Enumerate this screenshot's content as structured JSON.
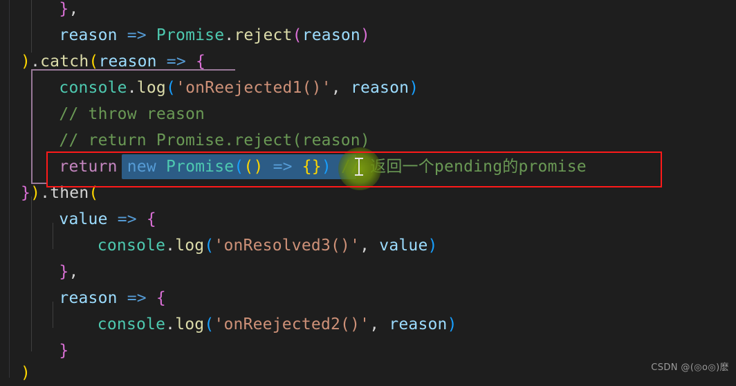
{
  "editor": {
    "app": "code-editor",
    "theme": "dark-plus",
    "background": "#1e1e1e",
    "font_size_px": 23,
    "line_height_px": 38
  },
  "colors": {
    "keyword_magenta": "#c586c0",
    "keyword_blue": "#569cd6",
    "class_teal": "#4ec9b0",
    "function_yellow": "#dcdcaa",
    "variable_blue": "#9cdcfe",
    "string_salmon": "#ce9178",
    "comment_green": "#6a9955",
    "bracket_yellow": "#ffd700",
    "bracket_pink": "#da70d6",
    "bracket_blue": "#179fff",
    "selection_blue": "#2c5c86",
    "annotation_red": "#ff1a1a",
    "scope_guide_purple": "#9a7a9a",
    "indent_guide_gray": "#404040",
    "click_glow_green": "#7ea010"
  },
  "code_lines": [
    {
      "id": "line-1",
      "indent": "    ",
      "tokens": [
        {
          "text": "}",
          "color": "bracket_pink"
        },
        {
          "text": ",",
          "color": "punct"
        }
      ],
      "plain": "    },"
    },
    {
      "id": "line-2",
      "indent": "    ",
      "tokens": [
        {
          "text": "reason",
          "color": "variable_blue"
        },
        {
          "text": " ",
          "color": "punct"
        },
        {
          "text": "=>",
          "color": "keyword_blue"
        },
        {
          "text": " ",
          "color": "punct"
        },
        {
          "text": "Promise",
          "color": "class_teal"
        },
        {
          "text": ".",
          "color": "punct"
        },
        {
          "text": "reject",
          "color": "function_yellow"
        },
        {
          "text": "(",
          "color": "bracket_pink"
        },
        {
          "text": "reason",
          "color": "variable_blue"
        },
        {
          "text": ")",
          "color": "bracket_pink"
        }
      ],
      "plain": "    reason => Promise.reject(reason)"
    },
    {
      "id": "line-3",
      "indent": "",
      "tokens": [
        {
          "text": ")",
          "color": "bracket_yellow"
        },
        {
          "text": ".",
          "color": "punct"
        },
        {
          "text": "catch",
          "color": "function_yellow"
        },
        {
          "text": "(",
          "color": "bracket_yellow"
        },
        {
          "text": "reason",
          "color": "variable_blue"
        },
        {
          "text": " ",
          "color": "punct"
        },
        {
          "text": "=>",
          "color": "keyword_blue"
        },
        {
          "text": " ",
          "color": "punct"
        },
        {
          "text": "{",
          "color": "bracket_pink"
        }
      ],
      "plain": ").catch(reason => {"
    },
    {
      "id": "line-4",
      "indent": "    ",
      "tokens": [
        {
          "text": "console",
          "color": "class_teal"
        },
        {
          "text": ".",
          "color": "punct"
        },
        {
          "text": "log",
          "color": "function_yellow"
        },
        {
          "text": "(",
          "color": "bracket_blue"
        },
        {
          "text": "'onReejected1()'",
          "color": "string_salmon"
        },
        {
          "text": ",",
          "color": "punct"
        },
        {
          "text": " ",
          "color": "punct"
        },
        {
          "text": "reason",
          "color": "variable_blue"
        },
        {
          "text": ")",
          "color": "bracket_blue"
        }
      ],
      "plain": "    console.log('onReejected1()', reason)"
    },
    {
      "id": "line-5",
      "indent": "    ",
      "tokens": [
        {
          "text": "// throw reason",
          "color": "comment_green"
        }
      ],
      "plain": "    // throw reason"
    },
    {
      "id": "line-6",
      "indent": "    ",
      "tokens": [
        {
          "text": "// return Promise.reject(reason)",
          "color": "comment_green"
        }
      ],
      "plain": "    // return Promise.reject(reason)"
    },
    {
      "id": "line-7",
      "indent": "    ",
      "highlighted": true,
      "tokens": [
        {
          "text": "return",
          "color": "keyword_magenta"
        },
        {
          "text": " ",
          "color": "punct"
        },
        {
          "text": "new",
          "color": "keyword_blue",
          "selected": true
        },
        {
          "text": " ",
          "color": "punct",
          "selected": true
        },
        {
          "text": "Promise",
          "color": "class_teal",
          "selected": true
        },
        {
          "text": "(",
          "color": "bracket_blue",
          "selected": true
        },
        {
          "text": "(",
          "color": "bracket_yellow",
          "selected": true
        },
        {
          "text": ")",
          "color": "bracket_yellow",
          "selected": true
        },
        {
          "text": " ",
          "color": "punct",
          "selected": true
        },
        {
          "text": "=>",
          "color": "keyword_blue",
          "selected": true
        },
        {
          "text": " ",
          "color": "punct",
          "selected": true
        },
        {
          "text": "{",
          "color": "bracket_yellow",
          "selected": true
        },
        {
          "text": "}",
          "color": "bracket_yellow",
          "selected": true
        },
        {
          "text": ")",
          "color": "bracket_blue",
          "selected": true
        },
        {
          "text": " ",
          "color": "punct"
        },
        {
          "text": "// 返回一个pending的promise",
          "color": "comment_green"
        }
      ],
      "plain": "    return new Promise(() => {}) // 返回一个pending的promise"
    },
    {
      "id": "line-8",
      "indent": "",
      "tokens": [
        {
          "text": "}",
          "color": "bracket_pink"
        },
        {
          "text": ")",
          "color": "bracket_yellow"
        },
        {
          "text": ".",
          "color": "punct"
        },
        {
          "text": "then",
          "color": "plain"
        },
        {
          "text": "(",
          "color": "bracket_yellow"
        }
      ],
      "plain": "}).then("
    },
    {
      "id": "line-9",
      "indent": "    ",
      "tokens": [
        {
          "text": "value",
          "color": "variable_blue"
        },
        {
          "text": " ",
          "color": "punct"
        },
        {
          "text": "=>",
          "color": "keyword_blue"
        },
        {
          "text": " ",
          "color": "punct"
        },
        {
          "text": "{",
          "color": "bracket_pink"
        }
      ],
      "plain": "    value => {"
    },
    {
      "id": "line-10",
      "indent": "        ",
      "tokens": [
        {
          "text": "console",
          "color": "class_teal"
        },
        {
          "text": ".",
          "color": "punct"
        },
        {
          "text": "log",
          "color": "function_yellow"
        },
        {
          "text": "(",
          "color": "bracket_blue"
        },
        {
          "text": "'onResolved3()'",
          "color": "string_salmon"
        },
        {
          "text": ",",
          "color": "punct"
        },
        {
          "text": " ",
          "color": "punct"
        },
        {
          "text": "value",
          "color": "variable_blue"
        },
        {
          "text": ")",
          "color": "bracket_blue"
        }
      ],
      "plain": "        console.log('onResolved3()', value)"
    },
    {
      "id": "line-11",
      "indent": "    ",
      "tokens": [
        {
          "text": "}",
          "color": "bracket_pink"
        },
        {
          "text": ",",
          "color": "punct"
        }
      ],
      "plain": "    },"
    },
    {
      "id": "line-12",
      "indent": "    ",
      "tokens": [
        {
          "text": "reason",
          "color": "variable_blue"
        },
        {
          "text": " ",
          "color": "punct"
        },
        {
          "text": "=>",
          "color": "keyword_blue"
        },
        {
          "text": " ",
          "color": "punct"
        },
        {
          "text": "{",
          "color": "bracket_pink"
        }
      ],
      "plain": "    reason => {"
    },
    {
      "id": "line-13",
      "indent": "        ",
      "tokens": [
        {
          "text": "console",
          "color": "class_teal"
        },
        {
          "text": ".",
          "color": "punct"
        },
        {
          "text": "log",
          "color": "function_yellow"
        },
        {
          "text": "(",
          "color": "bracket_blue"
        },
        {
          "text": "'onReejected2()'",
          "color": "string_salmon"
        },
        {
          "text": ",",
          "color": "punct"
        },
        {
          "text": " ",
          "color": "punct"
        },
        {
          "text": "reason",
          "color": "variable_blue"
        },
        {
          "text": ")",
          "color": "bracket_blue"
        }
      ],
      "plain": "        console.log('onReejected2()', reason)"
    },
    {
      "id": "line-14",
      "indent": "    ",
      "tokens": [
        {
          "text": "}",
          "color": "bracket_pink"
        }
      ],
      "plain": "    }"
    },
    {
      "id": "line-15",
      "indent": "",
      "tokens": [
        {
          "text": ")",
          "color": "bracket_yellow"
        }
      ],
      "plain": ")"
    }
  ],
  "annotation": {
    "type": "red-rectangle",
    "target_line_id": "line-7",
    "target_text": "return new Promise(() => {}) // 返回一个pending的promise"
  },
  "selection": {
    "line_id": "line-7",
    "selected_text": "new Promise(() => {})"
  },
  "mouse": {
    "cursor_type": "text-ibeam",
    "click_effect": "green-glow"
  },
  "watermark": {
    "text": "CSDN @(◎o◎)麽"
  }
}
